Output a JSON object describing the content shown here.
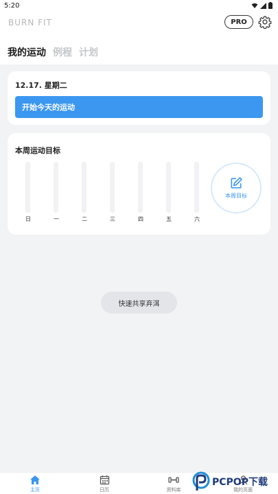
{
  "status": {
    "time": "5:20"
  },
  "header": {
    "logo": "BURN FIT",
    "pro_label": "PRO"
  },
  "tabs": [
    {
      "label": "我的运动",
      "active": true
    },
    {
      "label": "例程",
      "active": false
    },
    {
      "label": "计划",
      "active": false
    }
  ],
  "today": {
    "date": "12.17. 星期二",
    "start_label": "开始今天的运动"
  },
  "weekly": {
    "title": "本周运动目标",
    "days": [
      "日",
      "一",
      "二",
      "三",
      "四",
      "五",
      "六"
    ],
    "goal_label": "本周目标"
  },
  "share_label": "快速共享弃洱",
  "nav": [
    {
      "label": "主页",
      "icon": "home-icon",
      "active": true
    },
    {
      "label": "日历",
      "icon": "calendar-icon",
      "active": false
    },
    {
      "label": "资料库",
      "icon": "dumbbell-icon",
      "active": false
    },
    {
      "label": "我的页面",
      "icon": "user-icon",
      "active": false
    }
  ],
  "watermark": {
    "text": "PCPOP下载"
  },
  "colors": {
    "accent": "#3c97f0",
    "background": "#f2f3f5"
  }
}
